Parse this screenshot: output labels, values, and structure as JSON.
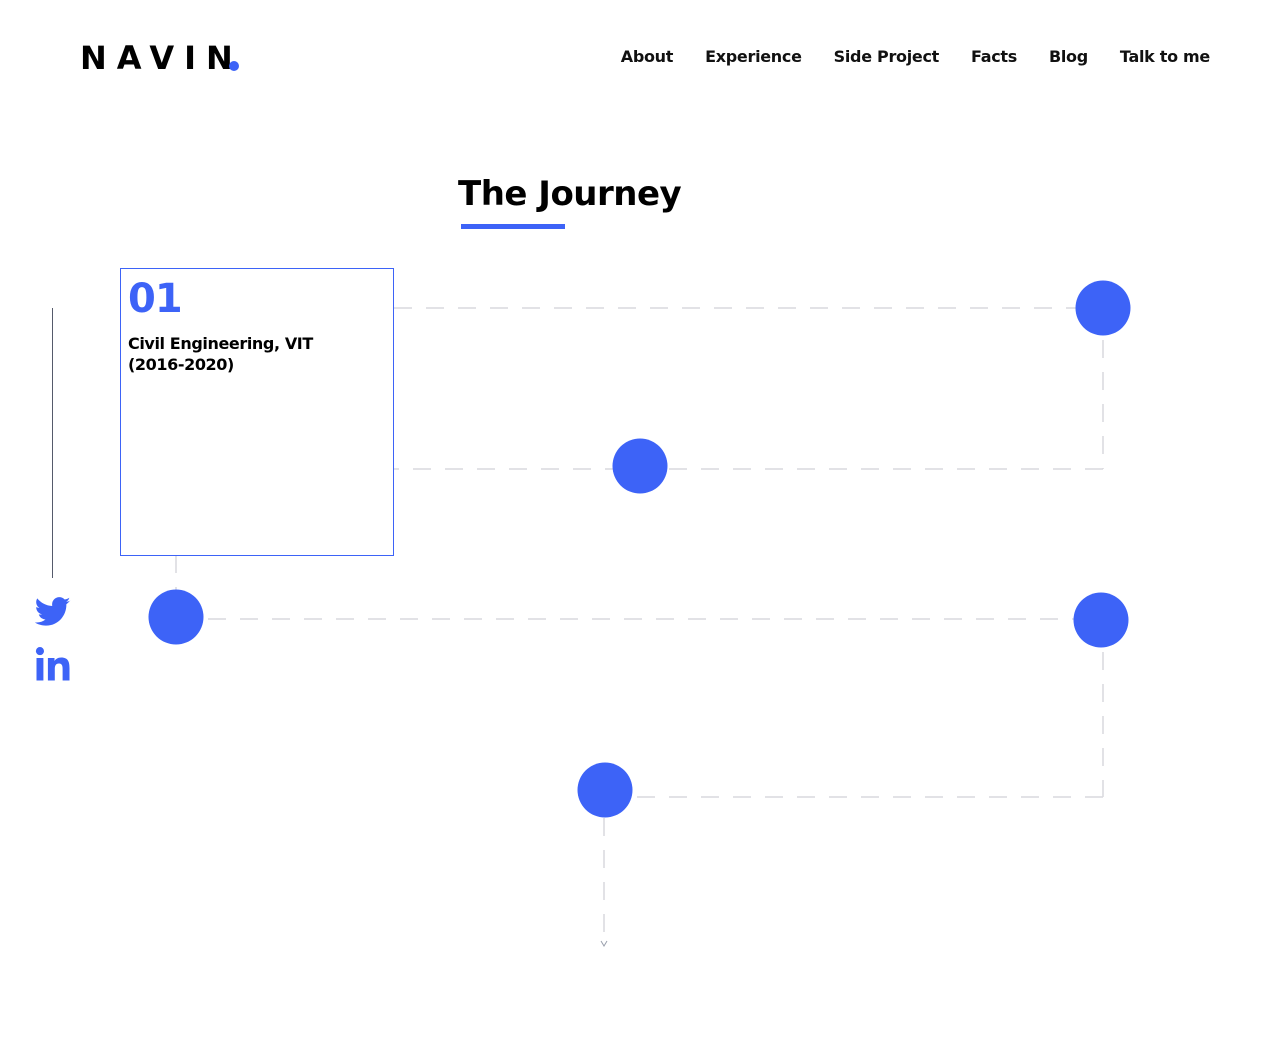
{
  "header": {
    "logo": "NAVIN",
    "nav": [
      {
        "label": "About"
      },
      {
        "label": "Experience"
      },
      {
        "label": "Side Project"
      },
      {
        "label": "Facts"
      },
      {
        "label": "Blog"
      },
      {
        "label": "Talk to me"
      }
    ]
  },
  "journey": {
    "title": "The Journey",
    "card": {
      "number": "01",
      "line1": "Civil Engineering, VIT",
      "line2": "(2016-2020)"
    }
  },
  "social": {
    "icons": [
      "twitter-icon",
      "linkedin-icon"
    ]
  },
  "colors": {
    "accent": "#3d63f7",
    "text": "#000000",
    "dash": "#d9d9de"
  }
}
